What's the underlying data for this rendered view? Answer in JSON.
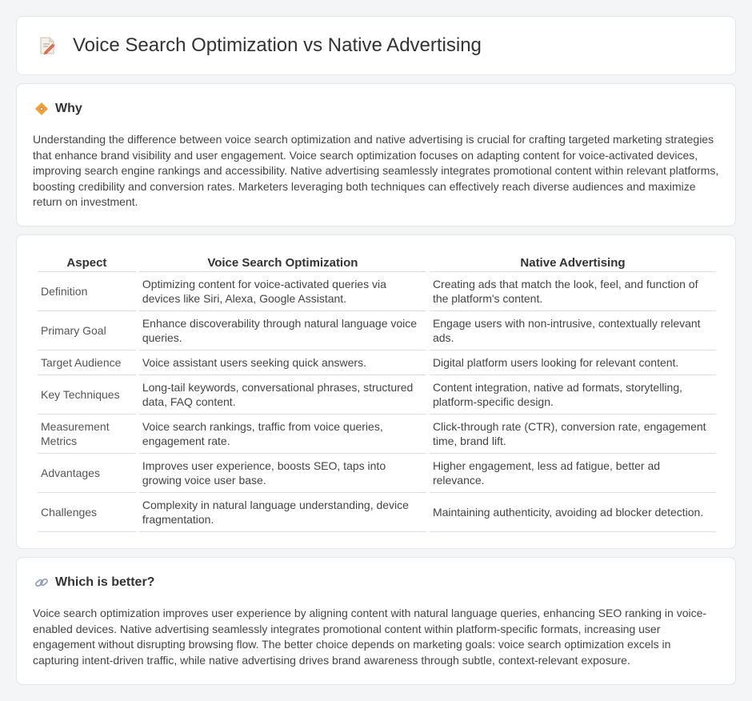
{
  "header": {
    "title": "Voice Search Optimization vs Native Advertising",
    "icon": "document-pencil-icon"
  },
  "why": {
    "icon": "diamond-signal-icon",
    "title": "Why",
    "text": "Understanding the difference between voice search optimization and native advertising is crucial for crafting targeted marketing strategies that enhance brand visibility and user engagement. Voice search optimization focuses on adapting content for voice-activated devices, improving search engine rankings and accessibility. Native advertising seamlessly integrates promotional content within relevant platforms, boosting credibility and conversion rates. Marketers leveraging both techniques can effectively reach diverse audiences and maximize return on investment."
  },
  "table": {
    "headers": [
      "Aspect",
      "Voice Search Optimization",
      "Native Advertising"
    ],
    "rows": [
      {
        "aspect": "Definition",
        "voice": "Optimizing content for voice-activated queries via devices like Siri, Alexa, Google Assistant.",
        "native": "Creating ads that match the look, feel, and function of the platform's content."
      },
      {
        "aspect": "Primary Goal",
        "voice": "Enhance discoverability through natural language voice queries.",
        "native": "Engage users with non-intrusive, contextually relevant ads."
      },
      {
        "aspect": "Target Audience",
        "voice": "Voice assistant users seeking quick answers.",
        "native": "Digital platform users looking for relevant content."
      },
      {
        "aspect": "Key Techniques",
        "voice": "Long-tail keywords, conversational phrases, structured data, FAQ content.",
        "native": "Content integration, native ad formats, storytelling, platform-specific design."
      },
      {
        "aspect": "Measurement Metrics",
        "voice": "Voice search rankings, traffic from voice queries, engagement rate.",
        "native": "Click-through rate (CTR), conversion rate, engagement time, brand lift."
      },
      {
        "aspect": "Advantages",
        "voice": "Improves user experience, boosts SEO, taps into growing voice user base.",
        "native": "Higher engagement, less ad fatigue, better ad relevance."
      },
      {
        "aspect": "Challenges",
        "voice": "Complexity in natural language understanding, device fragmentation.",
        "native": "Maintaining authenticity, avoiding ad blocker detection."
      }
    ]
  },
  "better": {
    "icon": "link-icon",
    "title": "Which is better?",
    "text": "Voice search optimization improves user experience by aligning content with natural language queries, enhancing SEO ranking in voice-enabled devices. Native advertising seamlessly integrates promotional content within platform-specific formats, increasing user engagement without disrupting browsing flow. The better choice depends on marketing goals: voice search optimization excels in capturing intent-driven traffic, while native advertising drives brand awareness through subtle, context-relevant exposure."
  },
  "colors": {
    "background": "#f4f5f7",
    "card": "#ffffff",
    "divider": "#dddddd",
    "icon_accent": "#e8744f"
  }
}
